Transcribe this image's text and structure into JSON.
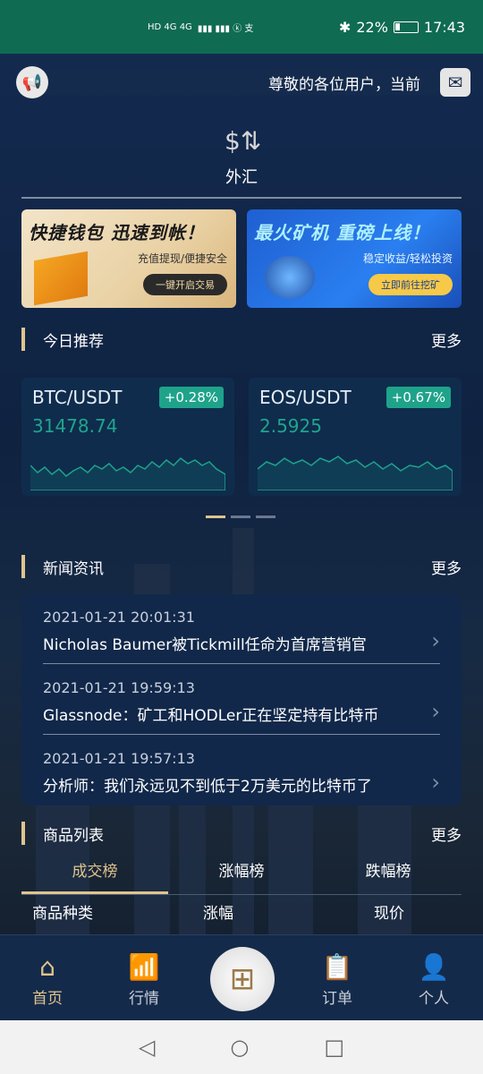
{
  "status": {
    "net": "HD 4G 4G",
    "battery": "22%",
    "time": "17:43"
  },
  "notice": {
    "text": "尊敬的各位用户，当前"
  },
  "forex": {
    "label": "外汇"
  },
  "banners": [
    {
      "title": "快捷钱包 迅速到帐！",
      "subtitle": "充值提现/便捷安全",
      "button": "一键开启交易"
    },
    {
      "title": "最火矿机 重磅上线！",
      "subtitle": "稳定收益/轻松投资",
      "button": "立即前往挖矿"
    }
  ],
  "recommend": {
    "title": "今日推荐",
    "more": "更多"
  },
  "tickers": [
    {
      "pair": "BTC/USDT",
      "change": "+0.28%",
      "price": "31478.74"
    },
    {
      "pair": "EOS/USDT",
      "change": "+0.67%",
      "price": "2.5925"
    }
  ],
  "news": {
    "title": "新闻资讯",
    "more": "更多",
    "items": [
      {
        "date": "2021-01-21 20:01:31",
        "headline": "Nicholas Baumer被Tickmill任命为首席营销官"
      },
      {
        "date": "2021-01-21 19:59:13",
        "headline": "Glassnode：矿工和HODLer正在坚定持有比特币"
      },
      {
        "date": "2021-01-21 19:57:13",
        "headline": "分析师：我们永远见不到低于2万美元的比特币了"
      }
    ]
  },
  "products": {
    "title": "商品列表",
    "more": "更多",
    "tabs": [
      "成交榜",
      "涨幅榜",
      "跌幅榜"
    ],
    "columns": [
      "商品种类",
      "涨幅",
      "现价"
    ]
  },
  "tabbar": {
    "home": "首页",
    "market": "行情",
    "orders": "订单",
    "profile": "个人"
  },
  "colors": {
    "accent": "#e0c48e",
    "up": "#1ea38a",
    "statusbar": "#0f6b52"
  }
}
